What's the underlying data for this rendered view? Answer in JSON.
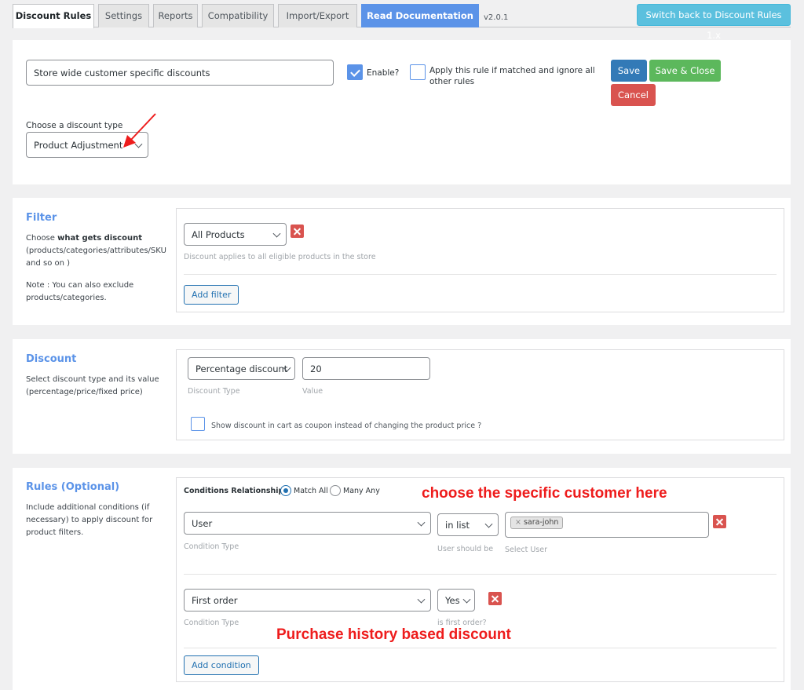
{
  "tabs": [
    {
      "label": "Discount Rules",
      "active": true
    },
    {
      "label": "Settings"
    },
    {
      "label": "Reports"
    },
    {
      "label": "Compatibility"
    },
    {
      "label": "Import/Export"
    },
    {
      "label": "Read Documentation",
      "style": "primary"
    }
  ],
  "version": "v2.0.1",
  "switch_back_label": "Switch back to Discount Rules 1.x",
  "rule": {
    "title_value": "Store wide customer specific discounts",
    "enable_label": "Enable?",
    "enable_checked": true,
    "exclusive_label": "Apply this rule if matched and ignore all other rules",
    "exclusive_checked": false,
    "save_label": "Save",
    "save_close_label": "Save & Close",
    "cancel_label": "Cancel",
    "discount_type_label": "Choose a discount type",
    "discount_type_value": "Product Adjustment"
  },
  "filter": {
    "title": "Filter",
    "desc_prefix": "Choose ",
    "desc_bold": "what gets discount",
    "desc_suffix": " (products/categories/attributes/SKU and so on )",
    "note": "Note : You can also exclude products/categories.",
    "select_value": "All Products",
    "hint": "Discount applies to all eligible products in the store",
    "add_label": "Add filter"
  },
  "discount": {
    "title": "Discount",
    "desc": "Select discount type and its value (percentage/price/fixed price)",
    "type_value": "Percentage discount",
    "type_hint": "Discount Type",
    "value": "20",
    "value_hint": "Value",
    "coupon_label": "Show discount in cart as coupon instead of changing the product price ?",
    "coupon_checked": false
  },
  "rules": {
    "title": "Rules (Optional)",
    "desc": "Include additional conditions (if necessary) to apply discount for product filters.",
    "relationship_label": "Conditions Relationship",
    "match_all_label": "Match All",
    "match_any_label": "Many Any",
    "selected_relationship": "Match All",
    "conditions": [
      {
        "type_value": "User",
        "type_hint": "Condition Type",
        "operator_value": "in list",
        "operator_hint": "User should be",
        "selected_users": [
          "sara-john"
        ],
        "users_hint": "Select User"
      },
      {
        "type_value": "First order",
        "type_hint": "Condition Type",
        "operator_value": "Yes",
        "operator_hint": "is first order?"
      }
    ],
    "add_condition_label": "Add condition"
  },
  "annotations": {
    "customer": "choose the specific customer here",
    "purchase_history": "Purchase history based discount",
    "color": "#ee1c1c"
  }
}
